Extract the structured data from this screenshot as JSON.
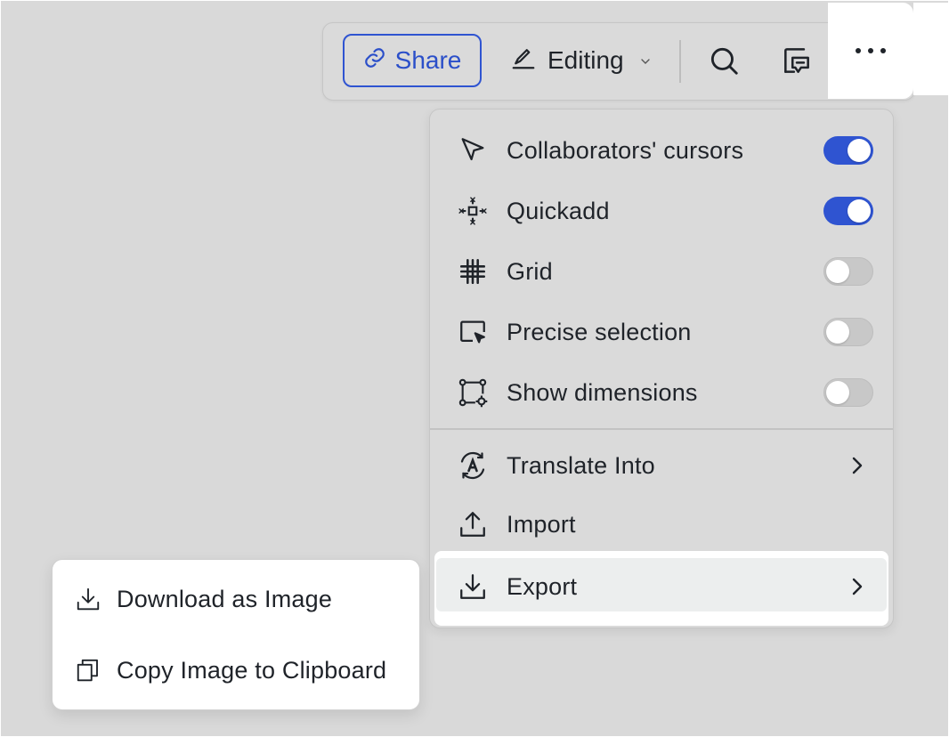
{
  "toolbar": {
    "share_label": "Share",
    "editing_label": "Editing",
    "icons": [
      "link-icon",
      "pen-icon",
      "chevron-down-icon",
      "search-icon",
      "comment-icon",
      "more-icon"
    ]
  },
  "menu": {
    "items": [
      {
        "label": "Collaborators' cursors",
        "icon": "cursor-icon",
        "toggle": true
      },
      {
        "label": "Quickadd",
        "icon": "quickadd-icon",
        "toggle": true
      },
      {
        "label": "Grid",
        "icon": "grid-icon",
        "toggle": false
      },
      {
        "label": "Precise selection",
        "icon": "precise-selection-icon",
        "toggle": false
      },
      {
        "label": "Show dimensions",
        "icon": "dimensions-icon",
        "toggle": false
      },
      {
        "label": "Translate Into",
        "icon": "translate-icon",
        "submenu": true
      },
      {
        "label": "Import",
        "icon": "upload-icon"
      },
      {
        "label": "Export",
        "icon": "download-icon",
        "submenu": true,
        "highlighted": true
      }
    ]
  },
  "submenu": {
    "items": [
      {
        "label": "Download as Image",
        "icon": "download-icon"
      },
      {
        "label": "Copy Image to Clipboard",
        "icon": "copy-icon"
      }
    ]
  },
  "colors": {
    "accent": "#2f54d1",
    "background": "#d9d9d9",
    "menu_background": "#dadada",
    "toggle_off": "#c8c8c8"
  }
}
